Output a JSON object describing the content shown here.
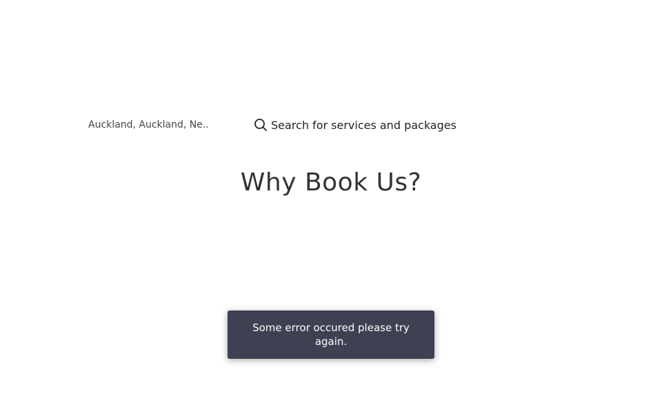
{
  "header": {
    "location_text": "Auckland, Auckland, Ne..",
    "search_placeholder": "Search for services and packages",
    "search_icon": "search-icon"
  },
  "main": {
    "heading": "Why Book Us?"
  },
  "toast": {
    "message": "Some error occured please try again.",
    "background_color": "#3d4152",
    "text_color": "#ffffff"
  }
}
